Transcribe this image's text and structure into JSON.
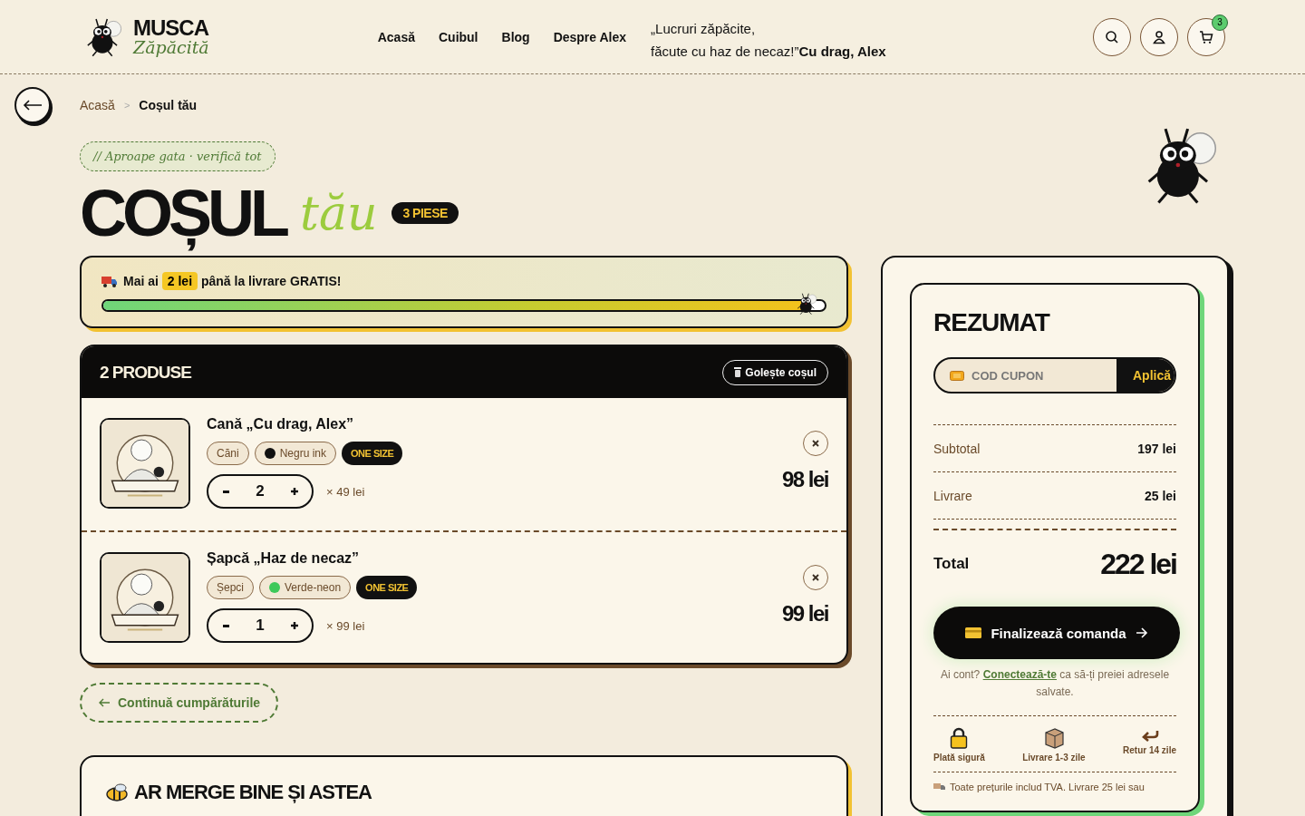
{
  "header": {
    "logo": {
      "line1": "MUSCA",
      "line2": "Zăpăcită"
    },
    "nav": [
      {
        "label": "Acasă"
      },
      {
        "label": "Cuibul"
      },
      {
        "label": "Blog"
      },
      {
        "label": "Despre Alex"
      }
    ],
    "quote": {
      "lines": [
        "„Lucruri zăpăcite,",
        "făcute cu haz de necaz!”"
      ],
      "signature": "Cu drag, Alex"
    },
    "cart_count": "3"
  },
  "breadcrumb_separator": ">",
  "breadcrumb": [
    {
      "label": "Acasă",
      "current": false
    },
    {
      "label": "Coșul tău",
      "current": true
    }
  ],
  "hero": {
    "tag": "// Aproape gata · verifică tot",
    "title": "COȘUL",
    "title_accent": "tău",
    "count_badge": "3 PIESE"
  },
  "shipping": {
    "prefix": "Mai ai",
    "amount": "2 lei",
    "suffix": "până la livrare GRATIS!",
    "level": 0.98
  },
  "cart": {
    "title": "2 PRODUSE",
    "clear_button": "Golește coșul",
    "items": [
      {
        "name": "Cană „Cu drag, Alex”",
        "tags": [
          {
            "kind": "category",
            "label": "Căni"
          },
          {
            "kind": "color",
            "label": "Negru ink",
            "color": "#111111"
          },
          {
            "kind": "size",
            "label": "ONE SIZE"
          }
        ],
        "quantity": "2",
        "unit_price": "× 49 lei",
        "total": "98 lei"
      },
      {
        "name": "Șapcă „Haz de necaz”",
        "tags": [
          {
            "kind": "category",
            "label": "Șepci"
          },
          {
            "kind": "color",
            "label": "Verde-neon",
            "color": "#3ec95a"
          },
          {
            "kind": "size",
            "label": "ONE SIZE"
          }
        ],
        "quantity": "1",
        "unit_price": "× 99 lei",
        "total": "99 lei"
      }
    ]
  },
  "continue_link": "Continuă cumpărăturile",
  "suggestions": {
    "title": "AR MERGE BINE ȘI ASTEA"
  },
  "summary": {
    "title": "REZUMAT",
    "coupon": {
      "placeholder": "COD CUPON",
      "button": "Aplică"
    },
    "rows": [
      {
        "label": "Subtotal",
        "value": "197 lei"
      },
      {
        "label": "Livrare",
        "value": "25 lei"
      }
    ],
    "total": {
      "label": "Total",
      "value": "222 lei"
    },
    "checkout": "Finalizează comanda",
    "login_note": {
      "before": "Ai cont?",
      "link": "Conectează-te",
      "after": "ca să-ți preiei adresele salvate."
    },
    "perks": [
      {
        "kind": "lock",
        "label": "Plată sigură"
      },
      {
        "kind": "box",
        "label": "Livrare 1-3 zile"
      },
      {
        "kind": "return",
        "label": "Retur 14 zile"
      }
    ],
    "footnote": "Toate prețurile includ TVA. Livrare 25 lei sau"
  }
}
